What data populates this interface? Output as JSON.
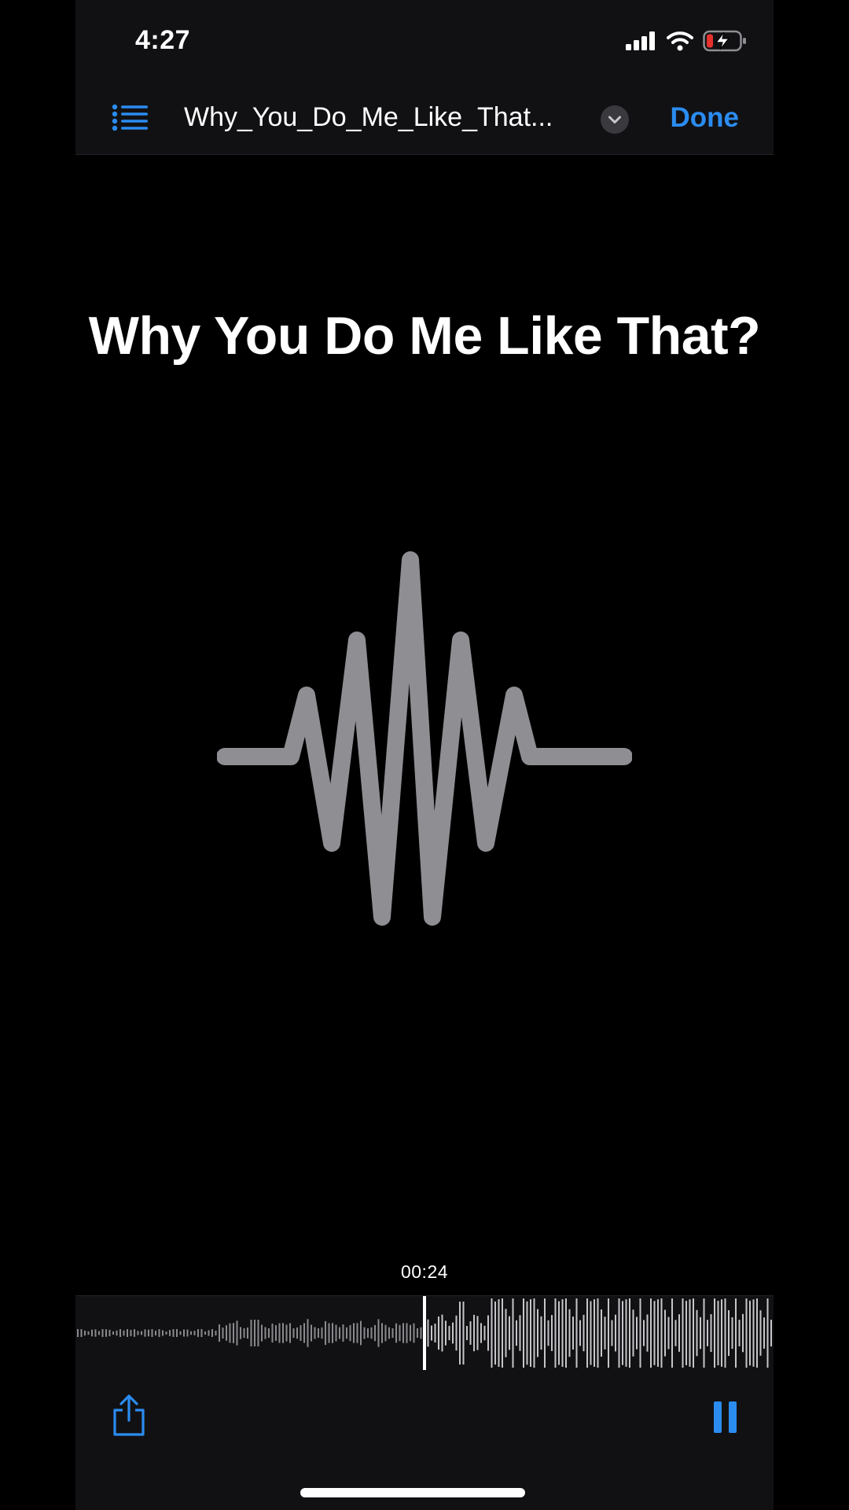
{
  "status_bar": {
    "time": "4:27",
    "icons": [
      "cellular-signal-icon",
      "wifi-icon",
      "battery-charging-icon"
    ]
  },
  "header": {
    "file_name": "Why_You_Do_Me_Like_That...",
    "done_label": "Done"
  },
  "main": {
    "song_title": "Why You Do Me Like That?",
    "artwork_icon": "waveform-icon"
  },
  "playback": {
    "current_time": "00:24"
  },
  "toolbar": {
    "icons": [
      "share-icon",
      "pause-icon"
    ]
  },
  "colors": {
    "accent": "#2b8cf0",
    "battery_low": "#e5322d",
    "waveform_art": "#8e8e93",
    "scrub_played": "#8a8a8e",
    "scrub_unplayed": "#c6c6ca"
  }
}
